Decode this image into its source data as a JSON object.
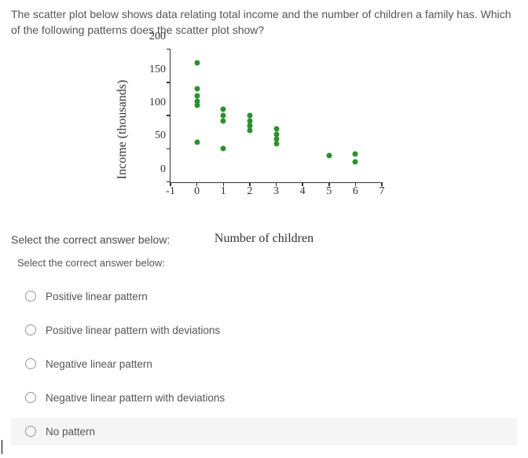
{
  "question": "The scatter plot below shows data relating total income and the number of children a family has. Which of the following patterns does the scatter plot show?",
  "select_header": "Select the correct answer below:",
  "select_dup": "Select the correct answer below:",
  "options": [
    {
      "label": "Positive linear pattern"
    },
    {
      "label": "Positive linear pattern with deviations"
    },
    {
      "label": "Negative linear pattern"
    },
    {
      "label": "Negative linear pattern with deviations"
    },
    {
      "label": "No pattern"
    }
  ],
  "chart_data": {
    "type": "scatter",
    "xlabel": "Number of children",
    "ylabel": "Income (thousands)",
    "xlim": [
      -1,
      7
    ],
    "ylim": [
      0,
      200
    ],
    "xticks": [
      -1,
      0,
      1,
      2,
      3,
      4,
      5,
      6,
      7
    ],
    "yticks": [
      0,
      50,
      100,
      150,
      200
    ],
    "points": [
      {
        "x": 0,
        "y": 180
      },
      {
        "x": 0,
        "y": 140
      },
      {
        "x": 0,
        "y": 130
      },
      {
        "x": 0,
        "y": 122
      },
      {
        "x": 0,
        "y": 115
      },
      {
        "x": 0,
        "y": 60
      },
      {
        "x": 1,
        "y": 110
      },
      {
        "x": 1,
        "y": 100
      },
      {
        "x": 1,
        "y": 92
      },
      {
        "x": 1,
        "y": 50
      },
      {
        "x": 2,
        "y": 100
      },
      {
        "x": 2,
        "y": 92
      },
      {
        "x": 2,
        "y": 85
      },
      {
        "x": 2,
        "y": 78
      },
      {
        "x": 3,
        "y": 80
      },
      {
        "x": 3,
        "y": 72
      },
      {
        "x": 3,
        "y": 65
      },
      {
        "x": 3,
        "y": 58
      },
      {
        "x": 5,
        "y": 40
      },
      {
        "x": 6,
        "y": 42
      },
      {
        "x": 6,
        "y": 30
      }
    ],
    "point_color": "#2b912b"
  }
}
